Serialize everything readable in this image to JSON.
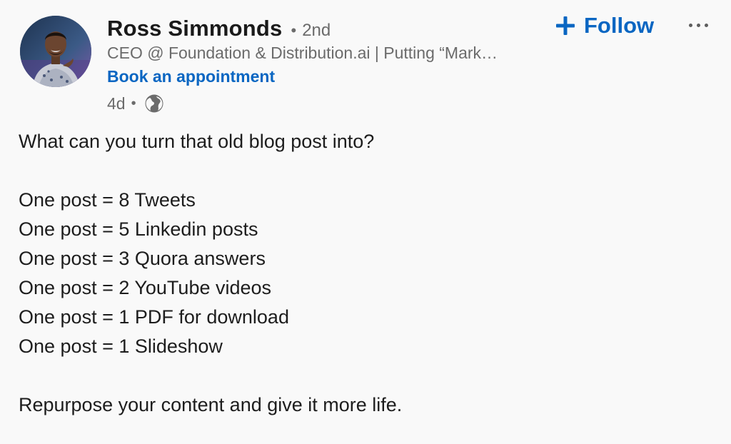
{
  "author": {
    "name": "Ross Simmonds",
    "separator": "•",
    "degree": "2nd",
    "headline": "CEO @ Foundation & Distribution.ai | Putting “Mark…",
    "link_label": "Book an appointment",
    "time": "4d",
    "time_separator": "•",
    "visibility_icon": "globe-icon"
  },
  "actions": {
    "follow_label": "Follow",
    "follow_icon": "plus-icon",
    "more_icon": "more-horizontal-icon"
  },
  "post": {
    "lines": [
      "What can you turn that old blog post into?",
      "",
      "One post = 8 Tweets",
      "One post = 5 Linkedin posts",
      "One post = 3 Quora answers",
      "One post = 2 YouTube videos",
      "One post = 1 PDF for download",
      "One post = 1 Slideshow",
      "",
      "Repurpose your content and give it more life."
    ]
  },
  "colors": {
    "background": "#f9f9f9",
    "link": "#0a66c2",
    "muted": "#6b6b6b",
    "text": "#1d1d1d"
  }
}
